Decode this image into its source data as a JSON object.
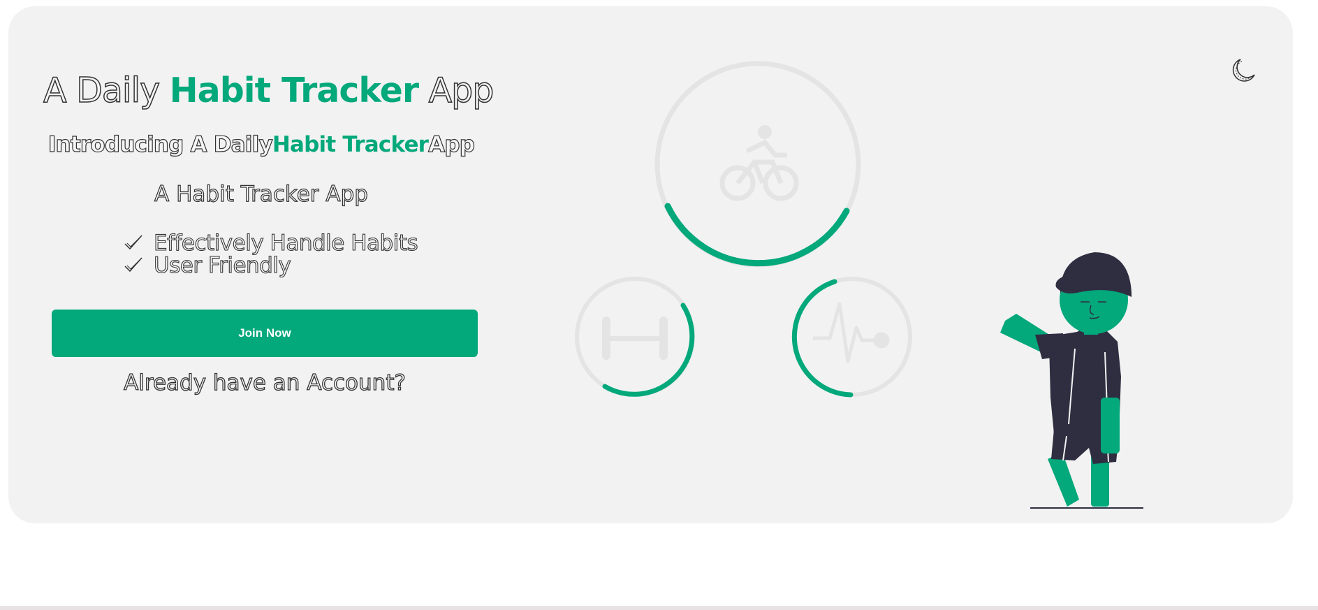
{
  "hero": {
    "title_pre": "A Daily ",
    "title_accent": "Habit Tracker",
    "title_post": " App",
    "subtitle_pre": "Introducing A Daily",
    "subtitle_accent": "Habit Tracker",
    "subtitle_post": "App",
    "tagline": "A Habit Tracker App"
  },
  "features": [
    {
      "text": "Effectively Handle Habits",
      "icon": "check-icon"
    },
    {
      "text": "User Friendly",
      "icon": "check-icon"
    }
  ],
  "actions": {
    "join_label": "Join Now",
    "login_link": "Already have an Account?"
  },
  "theme_toggle": {
    "icon": "moon-icon"
  },
  "colors": {
    "accent": "#03a87b",
    "card_bg": "#f2f2f2",
    "dark": "#2f2e41",
    "ring_bg": "#e4e4e4"
  },
  "progress_rings": [
    {
      "name": "cycling",
      "icon": "bicycle-icon",
      "progress": 0.42
    },
    {
      "name": "strength",
      "icon": "dumbbell-icon",
      "progress": 0.38
    },
    {
      "name": "heart",
      "icon": "heartbeat-icon",
      "progress": 0.55
    }
  ]
}
